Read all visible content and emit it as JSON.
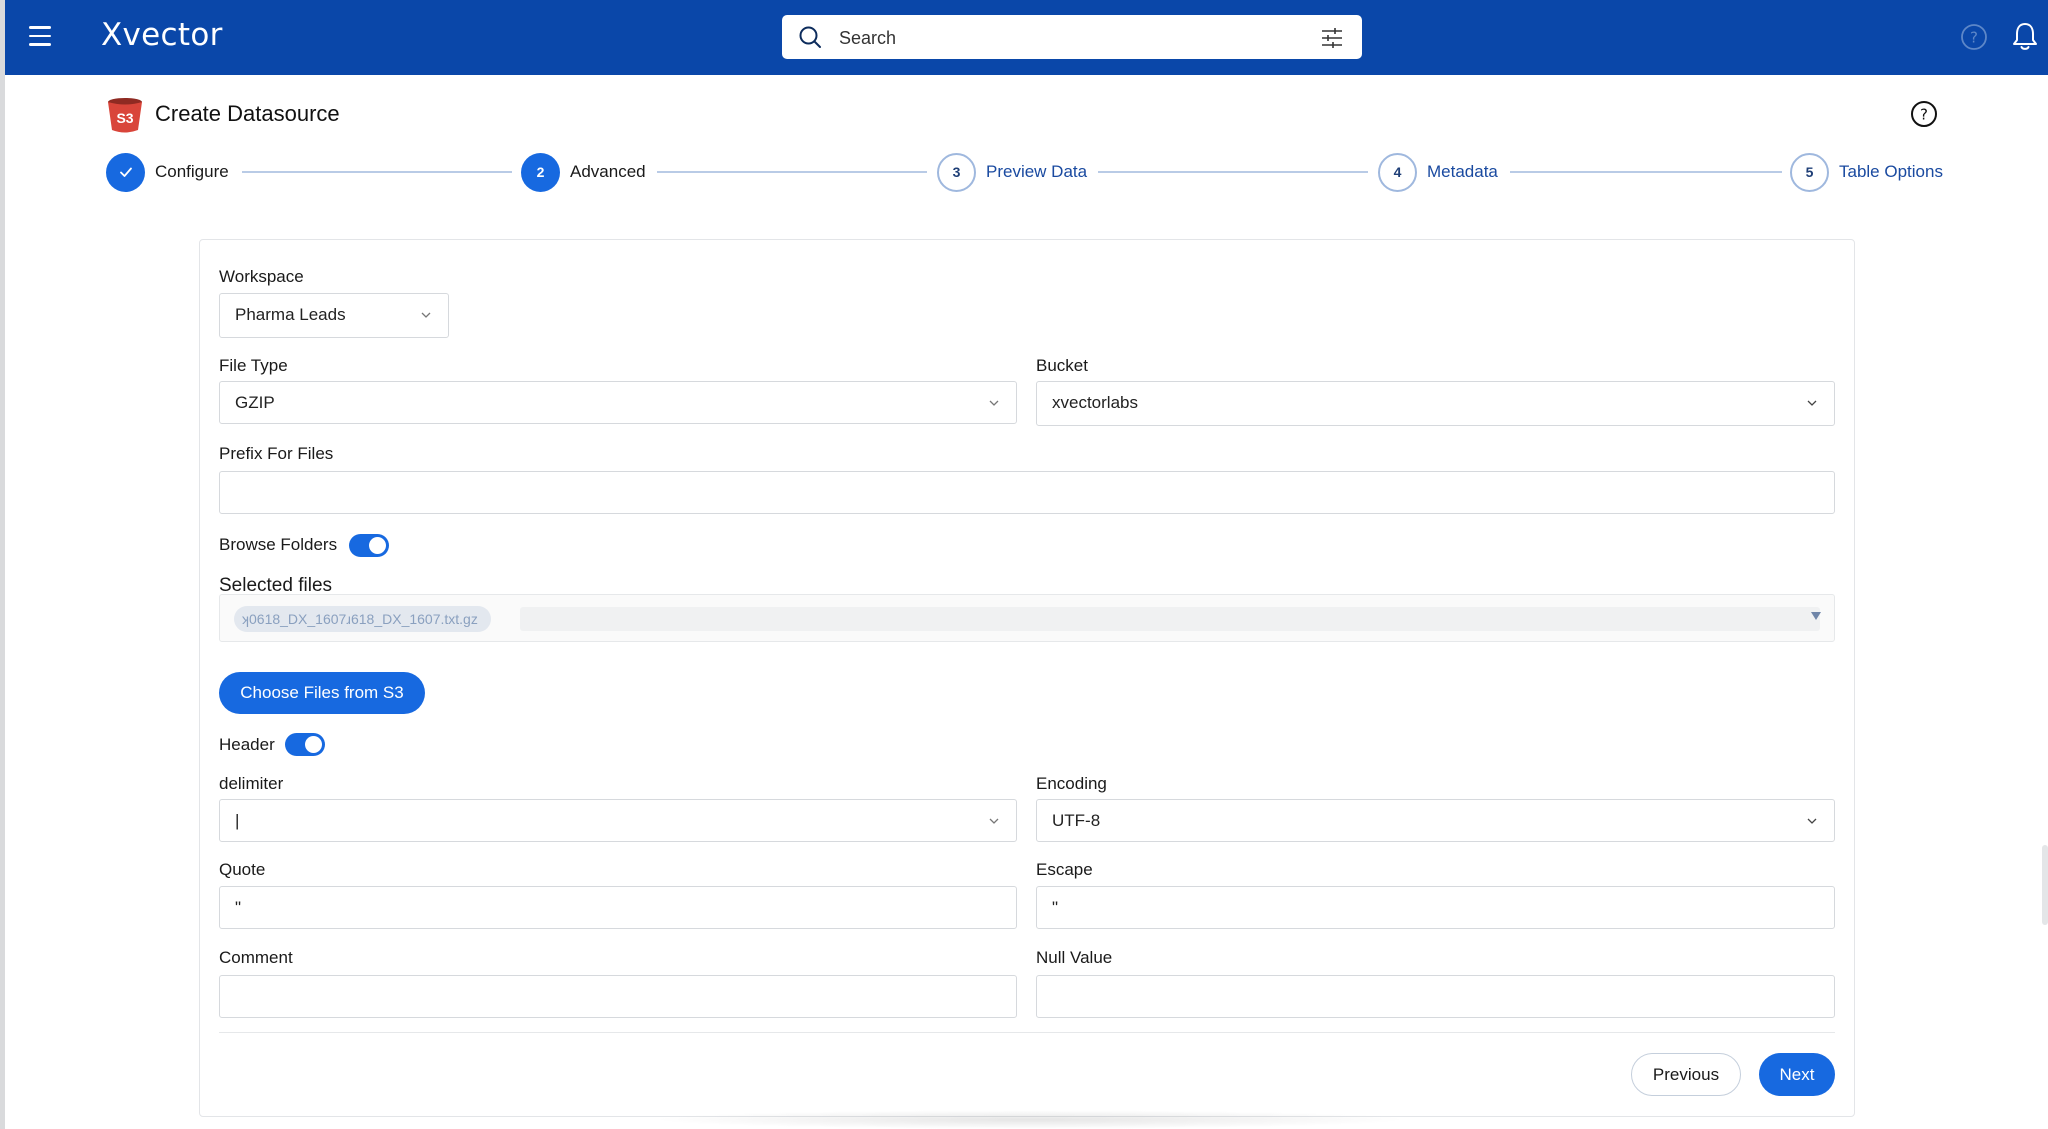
{
  "app": {
    "logo": "Xvector"
  },
  "search": {
    "placeholder": "Search"
  },
  "page": {
    "title": "Create Datasource"
  },
  "steps": [
    {
      "number": "✓",
      "label": "Configure",
      "state": "done"
    },
    {
      "number": "2",
      "label": "Advanced",
      "state": "active"
    },
    {
      "number": "3",
      "label": "Preview Data",
      "state": "pending"
    },
    {
      "number": "4",
      "label": "Metadata",
      "state": "pending"
    },
    {
      "number": "5",
      "label": "Table Options",
      "state": "pending"
    }
  ],
  "form": {
    "workspace": {
      "label": "Workspace",
      "value": "Pharma Leads"
    },
    "file_type": {
      "label": "File Type",
      "value": "GZIP"
    },
    "bucket": {
      "label": "Bucket",
      "value": "xvectorlabs"
    },
    "prefix": {
      "label": "Prefix For Files",
      "value": ""
    },
    "browse_folders": {
      "label": "Browse Folders",
      "on": true
    },
    "selected_files": {
      "label": "Selected files",
      "chip": "ʞ0618_DX_1607ɹ618_DX_1607.txt.gz"
    },
    "choose_files_label": "Choose Files from S3",
    "header": {
      "label": "Header",
      "on": true
    },
    "delimiter": {
      "label": "delimiter",
      "value": "|"
    },
    "encoding": {
      "label": "Encoding",
      "value": "UTF-8"
    },
    "quote": {
      "label": "Quote",
      "value": "\""
    },
    "escape": {
      "label": "Escape",
      "value": "\""
    },
    "comment": {
      "label": "Comment",
      "value": ""
    },
    "null_value": {
      "label": "Null Value",
      "value": ""
    }
  },
  "buttons": {
    "previous": "Previous",
    "next": "Next"
  },
  "colors": {
    "nav": "#0a47a9",
    "primary": "#1769e0",
    "s3": "#d9453a"
  },
  "icons": [
    "menu-icon",
    "search-icon",
    "filter-icon",
    "help-icon",
    "bell-icon",
    "s3-bucket-icon",
    "check-icon",
    "chevron-down-icon"
  ]
}
